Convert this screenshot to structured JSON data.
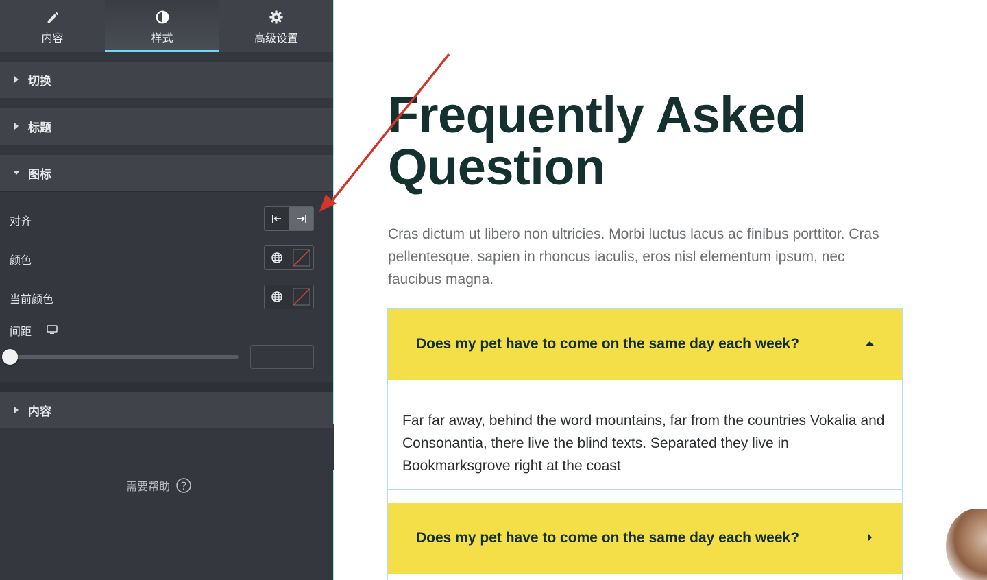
{
  "panel": {
    "tabs": [
      {
        "label": "内容",
        "icon": "pencil-icon"
      },
      {
        "label": "样式",
        "icon": "contrast-icon",
        "active": true
      },
      {
        "label": "高级设置",
        "icon": "gear-icon"
      }
    ],
    "sections": {
      "toggle": "切换",
      "title": "标题",
      "icon": "图标",
      "content": "内容"
    },
    "icon_controls": {
      "align_label": "对齐",
      "color_label": "颜色",
      "active_color_label": "当前颜色",
      "spacing_label": "间距",
      "spacing_value": "",
      "spacing_slider_fraction": 0.0,
      "align_selected": "right"
    },
    "help_label": "需要帮助"
  },
  "preview": {
    "title_line1": "Frequently Asked",
    "title_line2": "Question",
    "description": "Cras dictum ut libero non ultricies. Morbi luctus lacus ac finibus porttitor. Cras pellentesque, sapien in rhoncus iaculis, eros nisl elementum ipsum, nec faucibus magna.",
    "items": [
      {
        "question": "Does my pet have to come on the same day each week?",
        "answer": "Far far away, behind the word mountains, far from the countries Vokalia and Consonantia, there live the blind texts. Separated they live in Bookmarksgrove right at the coast",
        "expanded": true
      },
      {
        "question": "Does my pet have to come on the same day each week?",
        "expanded": false
      }
    ]
  },
  "colors": {
    "panel_bg": "#34383e",
    "section_bg": "#404349",
    "tab_active_underline": "#71d7f7",
    "accordion_header": "#f5df48",
    "title_text": "#14302f",
    "annotation_arrow": "#d0372c"
  }
}
